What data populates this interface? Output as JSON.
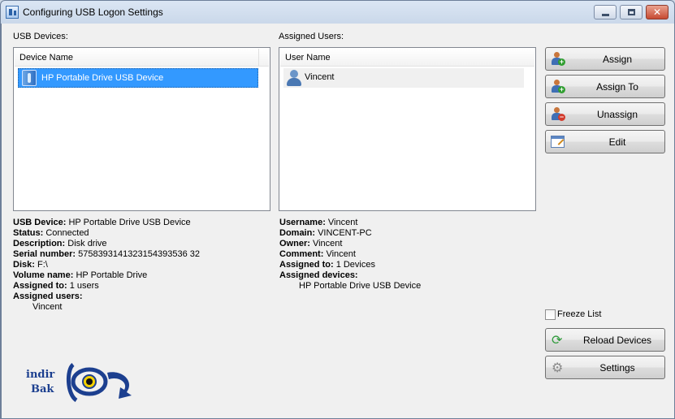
{
  "window": {
    "title": "Configuring USB Logon Settings",
    "close_glyph": "✕"
  },
  "usb_devices": {
    "label": "USB Devices:",
    "column": "Device Name",
    "items": [
      {
        "name": "HP Portable Drive USB Device",
        "icon": "usb-drive-icon",
        "selected": true
      }
    ]
  },
  "assigned_users": {
    "label": "Assigned Users:",
    "column": "User Name",
    "items": [
      {
        "name": "Vincent",
        "icon": "user-icon"
      }
    ]
  },
  "buttons": {
    "assign": "Assign",
    "assign_to": "Assign To",
    "unassign": "Unassign",
    "edit": "Edit",
    "reload": "Reload Devices",
    "settings": "Settings"
  },
  "device_info": {
    "usb_device_label": "USB Device:",
    "usb_device": "HP Portable Drive USB Device",
    "status_label": "Status:",
    "status": "Connected",
    "description_label": "Description:",
    "description": "Disk drive",
    "serial_label": "Serial number:",
    "serial": "5758393141323154393536 32",
    "disk_label": "Disk:",
    "disk": "F:\\",
    "volume_label": "Volume name:",
    "volume": "HP Portable Drive",
    "assigned_to_label": "Assigned to:",
    "assigned_to": "1 users",
    "assigned_users_label": "Assigned users:",
    "assigned_users": [
      "Vincent"
    ]
  },
  "user_info": {
    "username_label": "Username:",
    "username": "Vincent",
    "domain_label": "Domain:",
    "domain": "VINCENT-PC",
    "owner_label": "Owner:",
    "owner": "Vincent",
    "comment_label": "Comment:",
    "comment": "Vincent",
    "assigned_to_label": "Assigned to:",
    "assigned_to": "1 Devices",
    "assigned_devices_label": "Assigned devices:",
    "assigned_devices": [
      "HP Portable Drive USB Device"
    ]
  },
  "freeze_list": {
    "label": "Freeze List",
    "checked": false
  },
  "logo": {
    "line1": "indir",
    "line2": "Bak"
  },
  "colors": {
    "selection": "#3399ff",
    "client_bg": "#f0f0f0",
    "logo_blue": "#1c3f8f"
  }
}
